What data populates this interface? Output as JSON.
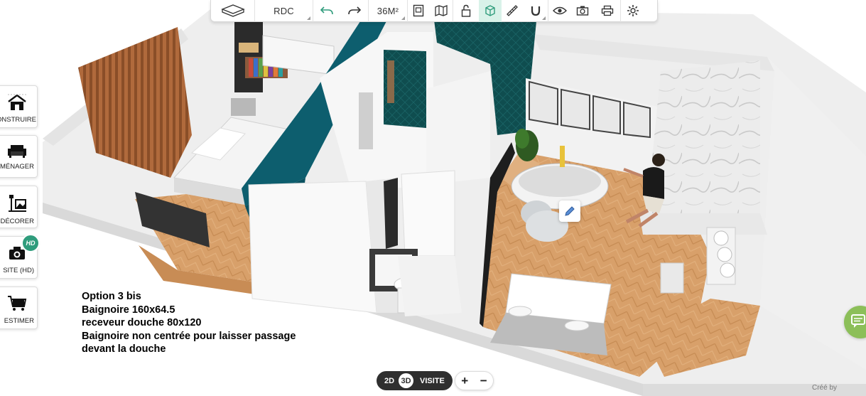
{
  "toolbar": {
    "level": "RDC",
    "area": "36M²",
    "icons": [
      "room-view-icon",
      "undo-icon",
      "redo-icon",
      "plan-icon",
      "map-icon",
      "unlock-icon",
      "cube-icon",
      "measure-icon",
      "magnet-icon",
      "eye-icon",
      "camera-icon",
      "print-icon",
      "settings-icon"
    ]
  },
  "left_panel": {
    "items": [
      {
        "label": "ONSTRUIRE",
        "icon": "house-icon"
      },
      {
        "label": "MÉNAGER",
        "icon": "sofa-icon"
      },
      {
        "label": "DÉCORER",
        "icon": "lamp-picture-icon"
      },
      {
        "label": "SITE (HD)",
        "icon": "camera-360-icon",
        "badge": "HD"
      },
      {
        "label": "ESTIMER",
        "icon": "cart-icon"
      }
    ]
  },
  "annotation": {
    "lines": [
      "Option 3 bis",
      "Baignoire 160x64.5",
      "receveur douche 80x120",
      "Baignoire non centrée pour laisser passage",
      "devant la douche"
    ]
  },
  "view_switch": {
    "mode_2d": "2D",
    "mode_3d": "3D",
    "visit": "VISITE"
  },
  "zoom": {
    "plus": "+",
    "minus": "−"
  },
  "colors": {
    "accent": "#2f9c7c",
    "teal_wall": "#0d5e6e",
    "floor": "#d79a5c",
    "chat": "#8cbf59"
  },
  "credit": "Créé by"
}
